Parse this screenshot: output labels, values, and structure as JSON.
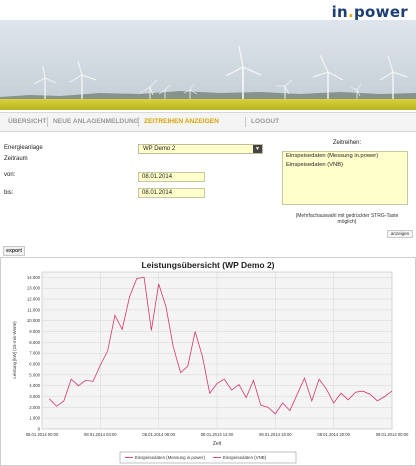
{
  "brand": {
    "part1": "in",
    "dot": ".",
    "part2": "power"
  },
  "nav": {
    "tabs": [
      {
        "label": "Übersicht",
        "active": false
      },
      {
        "label": "Neue Anlagenmeldung",
        "active": false
      },
      {
        "label": "Zeitreihen anzeigen",
        "active": true
      },
      {
        "label": "Logout",
        "active": false
      }
    ]
  },
  "form": {
    "energieanlage_label": "Energieanlage",
    "energieanlage_value": "WP Demo 2",
    "zeitraum_label": "Zeitraum",
    "von_label": "von:",
    "von_value": "08.01.2014",
    "bis_label": "bis:",
    "bis_value": "08.01.2014",
    "zeitreihen_label": "Zeitreihen:",
    "zeitreihen_options": [
      "Einspeisedaten (Messung in.power)",
      "Einspeisedaten (VNB)"
    ],
    "hint_line1": "(Mehrfachauswahl mit gedrückter STRG-Taste",
    "hint_line2": "möglich)",
    "anzeigen_label": "anzeigen"
  },
  "export_label": "export",
  "colors": {
    "accent": "#d9a200",
    "brand": "#1c3e72",
    "series": "#d6356a",
    "input_bg": "#ffffcc"
  },
  "chart_data": {
    "type": "line",
    "title": "Leistungsübersicht (WP Demo 2)",
    "xlabel": "Zeit",
    "ylabel": "Leistung [kW] (15-min-Werte)",
    "ylim": [
      0,
      14500
    ],
    "yticks": [
      0,
      1000,
      2000,
      3000,
      4000,
      5000,
      6000,
      7000,
      8000,
      9000,
      10000,
      11000,
      12000,
      13000,
      14000
    ],
    "xtick_labels": [
      "08.01.2014 00:00",
      "08.01.2014 04:00",
      "08.01.2014 08:00",
      "08.01.2014 12:00",
      "08.01.2014 16:00",
      "08.01.2014 20:00",
      "09.01.2014 00:00"
    ],
    "grid": true,
    "legend_position": "bottom",
    "series": [
      {
        "name": "Einspeisedaten (Messung in.power)",
        "color": "#d6356a",
        "hours": [
          0.5,
          1,
          1.5,
          2,
          2.5,
          3,
          3.5,
          4,
          4.5,
          5,
          5.5,
          6,
          6.5,
          7,
          7.5,
          8,
          8.5,
          9,
          9.5,
          10,
          10.5,
          11,
          11.5,
          12,
          12.5,
          13,
          13.5,
          14,
          14.5,
          15,
          15.5,
          16,
          16.5,
          17,
          17.5,
          18,
          18.5,
          19,
          19.5,
          20,
          20.5,
          21,
          21.5,
          22,
          22.5,
          23,
          23.5,
          24
        ],
        "values": [
          2800,
          2100,
          2600,
          4600,
          4000,
          4500,
          4400,
          5900,
          7200,
          10500,
          9200,
          12200,
          13900,
          14000,
          9100,
          13400,
          11300,
          7600,
          5200,
          5800,
          9000,
          6700,
          3300,
          4200,
          4600,
          3600,
          4100,
          2900,
          4500,
          2200,
          2000,
          1400,
          2400,
          1700,
          3200,
          4700,
          2600,
          4600,
          3700,
          2400,
          3300,
          2700,
          3400,
          3500,
          3200,
          2600,
          3000,
          3500
        ]
      },
      {
        "name": "Einspeisedaten (VNB)",
        "color": "#d6356a",
        "hours": [],
        "values": []
      }
    ]
  }
}
